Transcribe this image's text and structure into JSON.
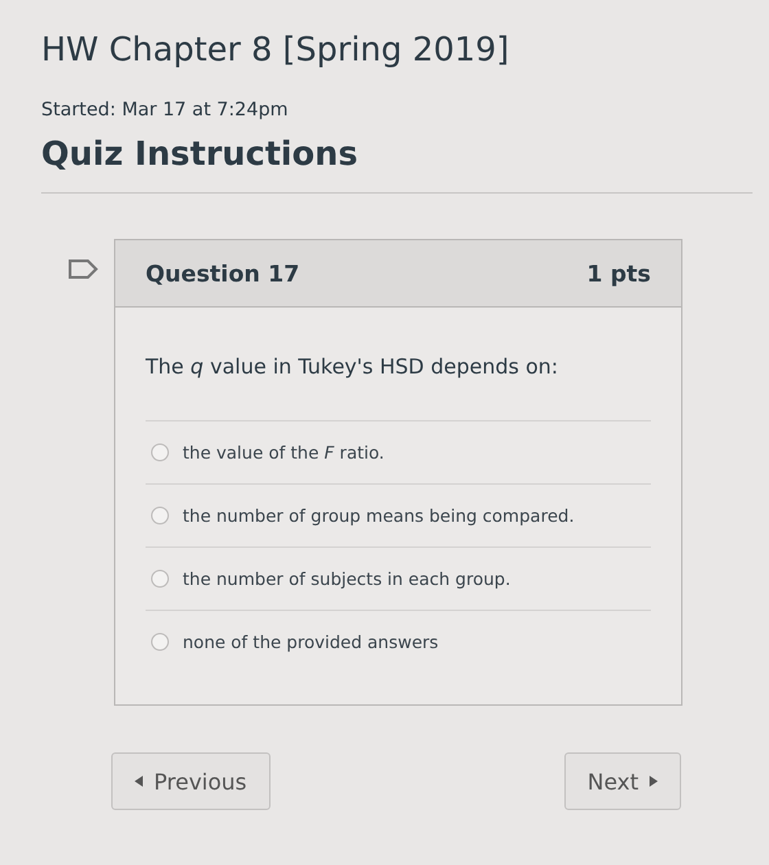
{
  "title": "HW Chapter 8 [Spring 2019]",
  "started": "Started: Mar 17 at 7:24pm",
  "section_heading": "Quiz Instructions",
  "question": {
    "flagged": false,
    "title": "Question 17",
    "points": "1 pts",
    "text": "The *q* value in Tukey's HSD depends on:",
    "answers": [
      {
        "label": "the value of the *F* ratio.",
        "selected": false
      },
      {
        "label": "the number of group means being compared.",
        "selected": false
      },
      {
        "label": "the number of subjects in each group.",
        "selected": false
      },
      {
        "label": "none of the provided answers",
        "selected": false
      }
    ]
  },
  "buttons": {
    "previous": "Previous",
    "next": "Next"
  }
}
